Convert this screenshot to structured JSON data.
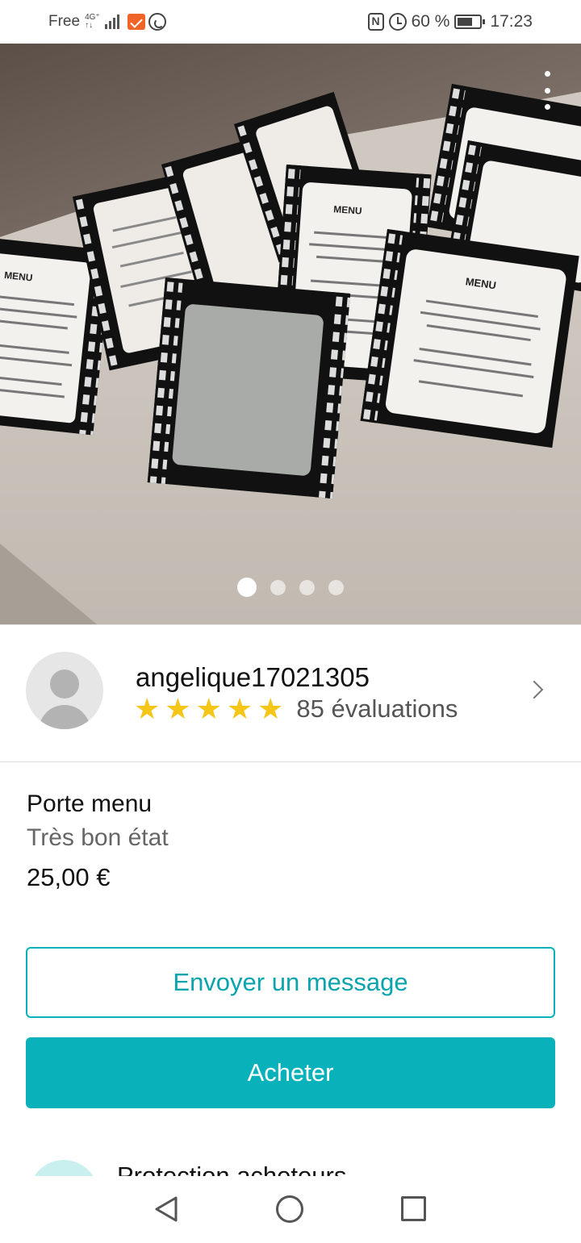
{
  "status_bar": {
    "carrier": "Free",
    "network": "4G⁺",
    "network_sub": "↑↓",
    "battery": "60 %",
    "time": "17:23",
    "icons": [
      "signal-icon",
      "notification-app-icon",
      "whatsapp-icon",
      "nfc-icon",
      "alarm-icon",
      "battery-icon"
    ]
  },
  "gallery": {
    "menu_heading": "MENU",
    "page_count": 4,
    "active_page": 1
  },
  "seller": {
    "username": "angelique17021305",
    "stars": 5,
    "rating_count": "85 évaluations"
  },
  "item": {
    "title": "Porte menu",
    "condition": "Très bon état",
    "price": "25,00 €"
  },
  "actions": {
    "message_label": "Envoyer un message",
    "buy_label": "Acheter"
  },
  "protection": {
    "label": "Protection acheteurs"
  },
  "colors": {
    "accent": "#09b1ba",
    "star": "#f5c518"
  }
}
